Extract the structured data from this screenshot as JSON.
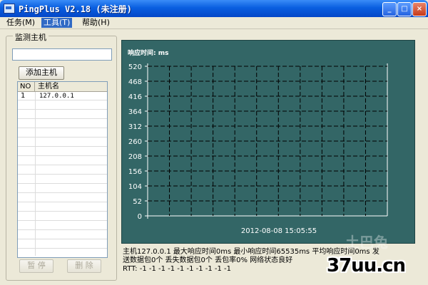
{
  "window": {
    "title": "PingPlus V2.18 (未注册)"
  },
  "titlebar_buttons": {
    "minimize": "_",
    "maximize": "□",
    "close": "×"
  },
  "menu": [
    {
      "label": "任务(M)"
    },
    {
      "label": "工具(T)"
    },
    {
      "label": "帮助(H)"
    }
  ],
  "left_panel": {
    "group_title": "监测主机",
    "host_input": {
      "value": "",
      "placeholder": ""
    },
    "add_button": "添加主机",
    "list": {
      "columns": [
        "NO",
        "主机名"
      ],
      "rows": [
        {
          "no": "1",
          "host": "127.0.0.1"
        }
      ]
    },
    "pause_button": "暂 停",
    "delete_button": "删 除"
  },
  "chart_data": {
    "type": "line",
    "title": "响应时间: ms",
    "y_ticks": [
      0,
      52,
      104,
      156,
      208,
      260,
      312,
      364,
      416,
      468,
      520
    ],
    "ylim": [
      0,
      520
    ],
    "grid": true,
    "grid_style": "dashed",
    "x_grid_lines": 10,
    "timestamp": "2012-08-08   15:05:55",
    "series": [],
    "colors": {
      "background": "#336666",
      "grid": "#000000",
      "text": "#ffffff"
    }
  },
  "status": {
    "line1": "主机127.0.0.1   最大响应时间0ms   最小响应时间65535ms   平均响应时间0ms   发",
    "line2": "送数据包0个   丢失数据包0个   丢包率0%   网络状态良好",
    "line3": "RTT: -1 -1 -1 -1 -1 -1 -1 -1 -1 -1"
  },
  "watermark": {
    "text": "37uu.cn",
    "ghost": "土巴兔"
  }
}
